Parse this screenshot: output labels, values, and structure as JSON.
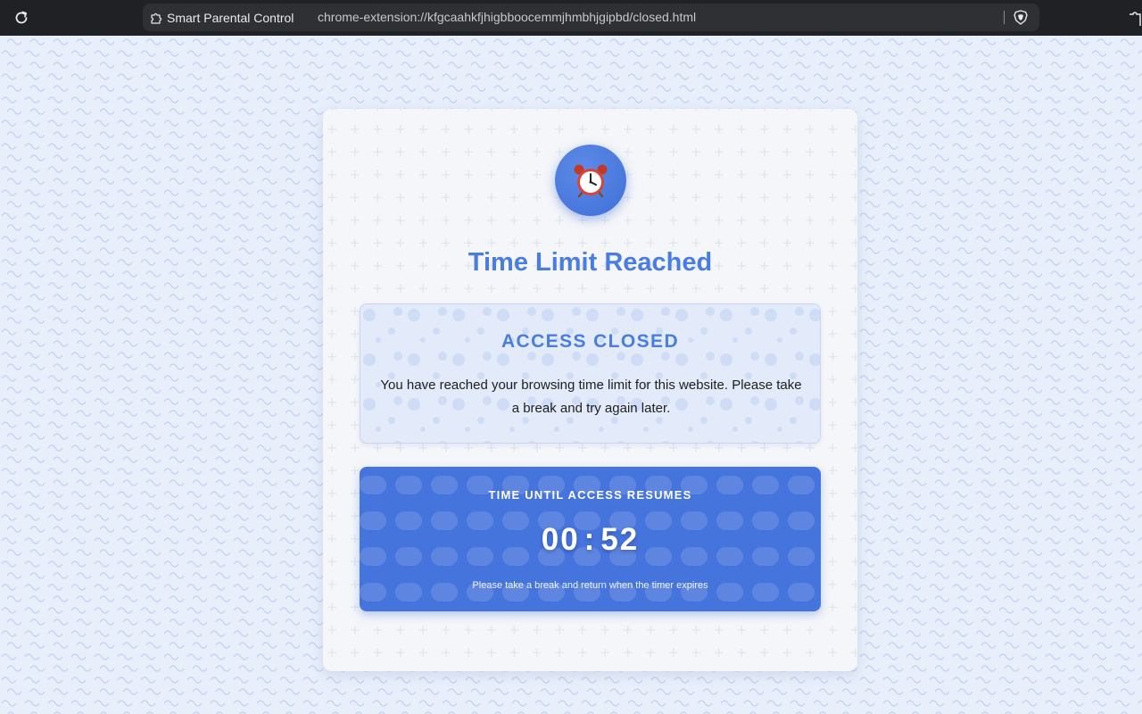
{
  "browser": {
    "extension_name": "Smart Parental Control",
    "url": "chrome-extension://kfgcaahkfjhigbboocemmjhmbhjgipbd/closed.html",
    "icons": {
      "reload": "reload-icon",
      "extension": "puzzle-icon",
      "shields": "brave-shield-icon"
    }
  },
  "page": {
    "icon": "alarm-clock-icon",
    "title": "Time Limit Reached",
    "access": {
      "heading": "ACCESS CLOSED",
      "message": "You have reached your browsing time limit for this website. Please take a break and try again later."
    },
    "timer": {
      "label": "TIME UNTIL ACCESS RESUMES",
      "minutes": "00",
      "separator": ":",
      "seconds": "52",
      "note": "Please take a break and return when the timer expires"
    }
  },
  "colors": {
    "accent": "#4a7de1",
    "timer_bg": "#4674dd",
    "browser_bar": "#202124",
    "page_bg": "#e8effb"
  }
}
